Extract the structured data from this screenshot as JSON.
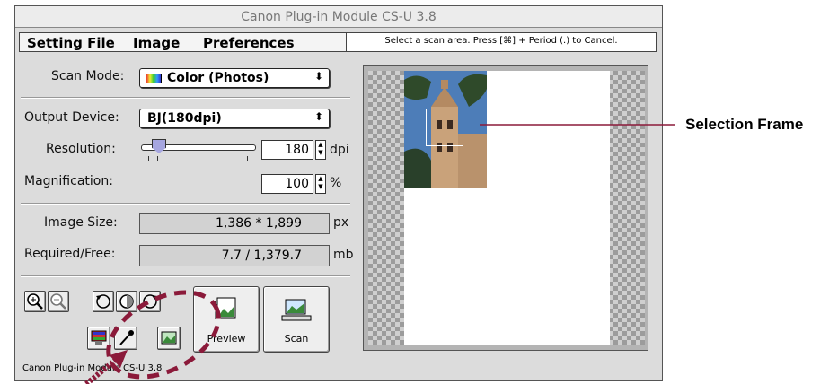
{
  "window": {
    "title": "Canon Plug-in Module CS-U 3.8",
    "footer": "Canon Plug-in Module CS-U 3.8"
  },
  "menubar": {
    "items": [
      "Setting File",
      "Image",
      "Preferences"
    ]
  },
  "status_message": "Select a scan area. Press [⌘] + Period (.) to Cancel.",
  "scan_mode": {
    "label": "Scan Mode:",
    "value": "Color (Photos)"
  },
  "output_device": {
    "label": "Output Device:",
    "value": "BJ(180dpi)"
  },
  "resolution": {
    "label": "Resolution:",
    "value": "180",
    "unit": "dpi",
    "slider_level": 0.2
  },
  "magnification": {
    "label": "Magnification:",
    "value": "100",
    "unit": "%"
  },
  "image_size": {
    "label": "Image Size:",
    "value": "1,386 * 1,899",
    "unit": "px"
  },
  "required_free": {
    "label": "Required/Free:",
    "value": "7.7 / 1,379.7",
    "unit": "mb"
  },
  "buttons": {
    "preview": "Preview",
    "scan": "Scan"
  },
  "callout": "Selection Frame",
  "colors": {
    "annotation": "#8b1a3a",
    "window_bg": "#dcdcdc"
  }
}
